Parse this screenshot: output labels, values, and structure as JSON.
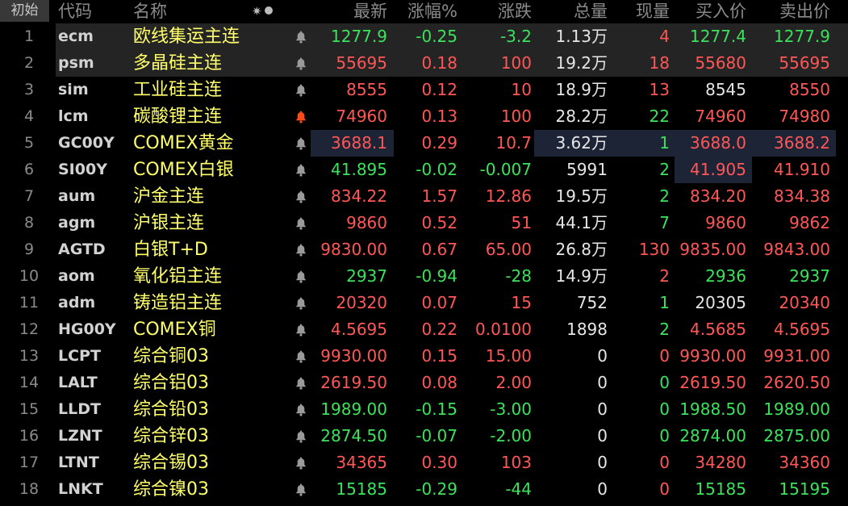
{
  "header": {
    "reset_label": "初始",
    "columns": {
      "code": "代码",
      "name": "名称",
      "last": "最新",
      "pct": "涨幅%",
      "chg": "涨跌",
      "vol": "总量",
      "cur": "现量",
      "bid": "买入价",
      "ask": "卖出价"
    },
    "icon_names": [
      "settings-gear-icon",
      "status-dot-icon"
    ]
  },
  "colors": {
    "up": "#ff5757",
    "down": "#3ce25c",
    "flat": "#e6e6e6",
    "name": "#ffff6a",
    "highlight_cell": "#1c2436",
    "selected_row": "#242424",
    "alert_bell_active": "#ff4a1a",
    "alert_bell_inactive": "#9a9a9a"
  },
  "rows": [
    {
      "idx": "1",
      "code": "ecm",
      "name": "欧线集运主连",
      "bell": "off",
      "last": "1277.9",
      "pct": "-0.25",
      "chg": "-3.2",
      "vol": "1.13万",
      "cur": "4",
      "bid": "1277.4",
      "ask": "1277.9",
      "c_last": "down",
      "c_pct": "down",
      "c_chg": "down",
      "c_cur": "up",
      "c_bid": "down",
      "c_ask": "down",
      "selected": true
    },
    {
      "idx": "2",
      "code": "psm",
      "name": "多晶硅主连",
      "bell": "off",
      "last": "55695",
      "pct": "0.18",
      "chg": "100",
      "vol": "19.2万",
      "cur": "18",
      "bid": "55680",
      "ask": "55695",
      "c_last": "up",
      "c_pct": "up",
      "c_chg": "up",
      "c_cur": "up",
      "c_bid": "up",
      "c_ask": "up",
      "selected": true
    },
    {
      "idx": "3",
      "code": "sim",
      "name": "工业硅主连",
      "bell": "off",
      "last": "8555",
      "pct": "0.12",
      "chg": "10",
      "vol": "18.9万",
      "cur": "13",
      "bid": "8545",
      "ask": "8550",
      "c_last": "up",
      "c_pct": "up",
      "c_chg": "up",
      "c_cur": "up",
      "c_bid": "flat",
      "c_ask": "up"
    },
    {
      "idx": "4",
      "code": "lcm",
      "name": "碳酸锂主连",
      "bell": "on",
      "last": "74960",
      "pct": "0.13",
      "chg": "100",
      "vol": "28.2万",
      "cur": "22",
      "bid": "74960",
      "ask": "74980",
      "c_last": "up",
      "c_pct": "up",
      "c_chg": "up",
      "c_cur": "down",
      "c_bid": "up",
      "c_ask": "up"
    },
    {
      "idx": "5",
      "code": "GC00Y",
      "name": "COMEX黄金",
      "bell": "off",
      "last": "3688.1",
      "pct": "0.29",
      "chg": "10.7",
      "vol": "3.62万",
      "cur": "1",
      "bid": "3688.0",
      "ask": "3688.2",
      "c_last": "up",
      "c_pct": "up",
      "c_chg": "up",
      "c_cur": "down",
      "c_bid": "up",
      "c_ask": "up",
      "hl": [
        "last",
        "vol",
        "cur",
        "bid",
        "ask"
      ]
    },
    {
      "idx": "6",
      "code": "SI00Y",
      "name": "COMEX白银",
      "bell": "off",
      "last": "41.895",
      "pct": "-0.02",
      "chg": "-0.007",
      "vol": "5991",
      "cur": "2",
      "bid": "41.905",
      "ask": "41.910",
      "c_last": "down",
      "c_pct": "down",
      "c_chg": "down",
      "c_cur": "down",
      "c_bid": "up",
      "c_ask": "up",
      "hl": [
        "bid"
      ]
    },
    {
      "idx": "7",
      "code": "aum",
      "name": "沪金主连",
      "bell": "off",
      "last": "834.22",
      "pct": "1.57",
      "chg": "12.86",
      "vol": "19.5万",
      "cur": "2",
      "bid": "834.20",
      "ask": "834.38",
      "c_last": "up",
      "c_pct": "up",
      "c_chg": "up",
      "c_cur": "down",
      "c_bid": "up",
      "c_ask": "up"
    },
    {
      "idx": "8",
      "code": "agm",
      "name": "沪银主连",
      "bell": "off",
      "last": "9860",
      "pct": "0.52",
      "chg": "51",
      "vol": "44.1万",
      "cur": "7",
      "bid": "9860",
      "ask": "9862",
      "c_last": "up",
      "c_pct": "up",
      "c_chg": "up",
      "c_cur": "down",
      "c_bid": "up",
      "c_ask": "up"
    },
    {
      "idx": "9",
      "code": "AGTD",
      "name": "白银T+D",
      "bell": "off",
      "last": "9830.00",
      "pct": "0.67",
      "chg": "65.00",
      "vol": "26.8万",
      "cur": "130",
      "bid": "9835.00",
      "ask": "9843.00",
      "c_last": "up",
      "c_pct": "up",
      "c_chg": "up",
      "c_cur": "up",
      "c_bid": "up",
      "c_ask": "up"
    },
    {
      "idx": "10",
      "code": "aom",
      "name": "氧化铝主连",
      "bell": "off",
      "last": "2937",
      "pct": "-0.94",
      "chg": "-28",
      "vol": "14.9万",
      "cur": "2",
      "bid": "2936",
      "ask": "2937",
      "c_last": "down",
      "c_pct": "down",
      "c_chg": "down",
      "c_cur": "up",
      "c_bid": "down",
      "c_ask": "down"
    },
    {
      "idx": "11",
      "code": "adm",
      "name": "铸造铝主连",
      "bell": "off",
      "last": "20320",
      "pct": "0.07",
      "chg": "15",
      "vol": "752",
      "cur": "1",
      "bid": "20305",
      "ask": "20340",
      "c_last": "up",
      "c_pct": "up",
      "c_chg": "up",
      "c_cur": "down",
      "c_bid": "flat",
      "c_ask": "up"
    },
    {
      "idx": "12",
      "code": "HG00Y",
      "name": "COMEX铜",
      "bell": "off",
      "last": "4.5695",
      "pct": "0.22",
      "chg": "0.0100",
      "vol": "1898",
      "cur": "2",
      "bid": "4.5685",
      "ask": "4.5695",
      "c_last": "up",
      "c_pct": "up",
      "c_chg": "up",
      "c_cur": "down",
      "c_bid": "up",
      "c_ask": "up"
    },
    {
      "idx": "13",
      "code": "LCPT",
      "name": "综合铜03",
      "bell": "off",
      "last": "9930.00",
      "pct": "0.15",
      "chg": "15.00",
      "vol": "0",
      "cur": "0",
      "bid": "9930.00",
      "ask": "9931.00",
      "c_last": "up",
      "c_pct": "up",
      "c_chg": "up",
      "c_cur": "up",
      "c_bid": "up",
      "c_ask": "up"
    },
    {
      "idx": "14",
      "code": "LALT",
      "name": "综合铝03",
      "bell": "off",
      "last": "2619.50",
      "pct": "0.08",
      "chg": "2.00",
      "vol": "0",
      "cur": "0",
      "bid": "2619.50",
      "ask": "2620.50",
      "c_last": "up",
      "c_pct": "up",
      "c_chg": "up",
      "c_cur": "down",
      "c_bid": "up",
      "c_ask": "up"
    },
    {
      "idx": "15",
      "code": "LLDT",
      "name": "综合铅03",
      "bell": "off",
      "last": "1989.00",
      "pct": "-0.15",
      "chg": "-3.00",
      "vol": "0",
      "cur": "0",
      "bid": "1988.50",
      "ask": "1989.00",
      "c_last": "down",
      "c_pct": "down",
      "c_chg": "down",
      "c_cur": "down",
      "c_bid": "down",
      "c_ask": "down"
    },
    {
      "idx": "16",
      "code": "LZNT",
      "name": "综合锌03",
      "bell": "off",
      "last": "2874.50",
      "pct": "-0.07",
      "chg": "-2.00",
      "vol": "0",
      "cur": "0",
      "bid": "2874.00",
      "ask": "2875.00",
      "c_last": "down",
      "c_pct": "down",
      "c_chg": "down",
      "c_cur": "down",
      "c_bid": "down",
      "c_ask": "down"
    },
    {
      "idx": "17",
      "code": "LTNT",
      "name": "综合锡03",
      "bell": "off",
      "last": "34365",
      "pct": "0.30",
      "chg": "103",
      "vol": "0",
      "cur": "0",
      "bid": "34280",
      "ask": "34360",
      "c_last": "up",
      "c_pct": "up",
      "c_chg": "up",
      "c_cur": "up",
      "c_bid": "up",
      "c_ask": "up"
    },
    {
      "idx": "18",
      "code": "LNKT",
      "name": "综合镍03",
      "bell": "off",
      "last": "15185",
      "pct": "-0.29",
      "chg": "-44",
      "vol": "0",
      "cur": "0",
      "bid": "15185",
      "ask": "15195",
      "c_last": "down",
      "c_pct": "down",
      "c_chg": "down",
      "c_cur": "up",
      "c_bid": "down",
      "c_ask": "down"
    }
  ]
}
